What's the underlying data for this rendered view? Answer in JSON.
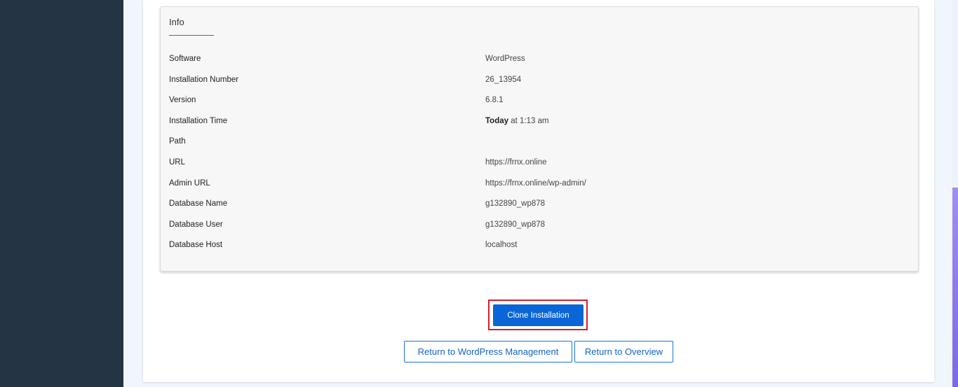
{
  "info": {
    "title": "Info",
    "rows": [
      {
        "label": "Software",
        "value": "WordPress"
      },
      {
        "label": "Installation Number",
        "value": "26_13954"
      },
      {
        "label": "Version",
        "value": "6.8.1"
      },
      {
        "label": "Installation Time",
        "value_bold": "Today",
        "value": " at 1:13 am"
      },
      {
        "label": "Path",
        "value": ""
      },
      {
        "label": "URL",
        "value": "https://frnx.online"
      },
      {
        "label": "Admin URL",
        "value": "https://frnx.online/wp-admin/"
      },
      {
        "label": "Database Name",
        "value": "g132890_wp878"
      },
      {
        "label": "Database User",
        "value": "g132890_wp878"
      },
      {
        "label": "Database Host",
        "value": "localhost"
      }
    ]
  },
  "actions": {
    "clone_label": "Clone Installation",
    "return_wp_label": "Return to WordPress Management",
    "return_overview_label": "Return to Overview"
  },
  "colors": {
    "sidebar": "#253444",
    "primary": "#0a66d6",
    "highlight": "#d3202a",
    "scrollbar": "#7b68e8"
  }
}
